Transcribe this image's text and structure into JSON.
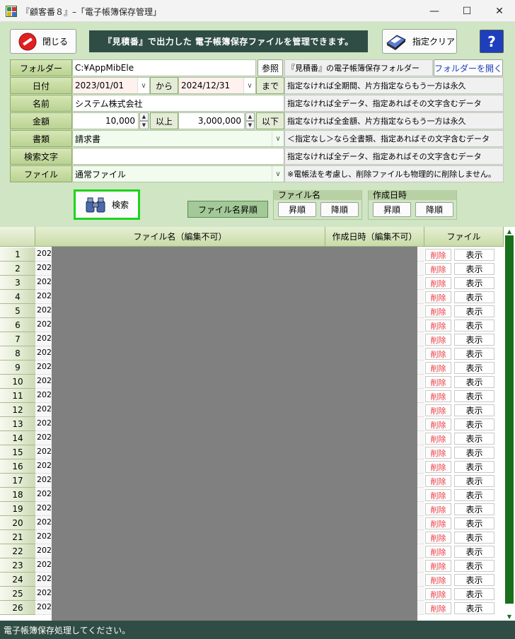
{
  "window": {
    "title": "『顧客番８』–「電子帳簿保存管理」",
    "minimize_glyph": "—",
    "maximize_glyph": "☐",
    "close_glyph": "✕"
  },
  "toolbar": {
    "close_label": "閉じる",
    "banner": "『見積番』で出力した 電子帳簿保存ファイルを管理できます。",
    "clear_label": "指定クリア",
    "help_glyph": "?"
  },
  "form": {
    "folder": {
      "label": "フォルダー",
      "value": "C:¥AppMibEle",
      "browse": "参照",
      "note": "『見積番』の電子帳簿保存フォルダー",
      "open": "フォルダーを開く"
    },
    "date": {
      "label": "日付",
      "from": "2023/01/01",
      "from_sep": "から",
      "to": "2024/12/31",
      "to_sep": "まで",
      "note": "指定なければ全期間、片方指定ならもう一方は永久"
    },
    "name": {
      "label": "名前",
      "value": "システム株式会社",
      "note": "指定なければ全データ、指定あればその文字含むデータ"
    },
    "amount": {
      "label": "金額",
      "min": "10,000",
      "min_sep": "以上",
      "max": "3,000,000",
      "max_sep": "以下",
      "note": "指定なければ全金額、片方指定ならもう一方は永久"
    },
    "doctype": {
      "label": "書類",
      "value": "請求書",
      "note": "＜指定なし＞なら全書類、指定あればその文字含むデータ"
    },
    "keyword": {
      "label": "検索文字",
      "value": "",
      "note": "指定なければ全データ、指定あればその文字含むデータ"
    },
    "file": {
      "label": "ファイル",
      "value": "通常ファイル",
      "note": "※電帳法を考慮し、削除ファイルも物理的に削除しません。"
    }
  },
  "actions": {
    "search_label": "検索",
    "sort_state": "ファイル名昇順",
    "sort_name": {
      "title": "ファイル名",
      "asc": "昇順",
      "desc": "降順"
    },
    "sort_date": {
      "title": "作成日時",
      "asc": "昇順",
      "desc": "降順"
    }
  },
  "table": {
    "columns": [
      "ファイル名（編集不可）",
      "作成日時（編集不可）",
      "ファイル"
    ],
    "name_prefix": "202",
    "delete_label": "削除",
    "show_label": "表示",
    "rows": [
      "1",
      "2",
      "3",
      "4",
      "5",
      "6",
      "7",
      "8",
      "9",
      "10",
      "11",
      "12",
      "13",
      "14",
      "15",
      "16",
      "17",
      "18",
      "19",
      "20",
      "21",
      "22",
      "23",
      "24",
      "25",
      "26"
    ]
  },
  "status": "電子帳簿保存処理してください。"
}
